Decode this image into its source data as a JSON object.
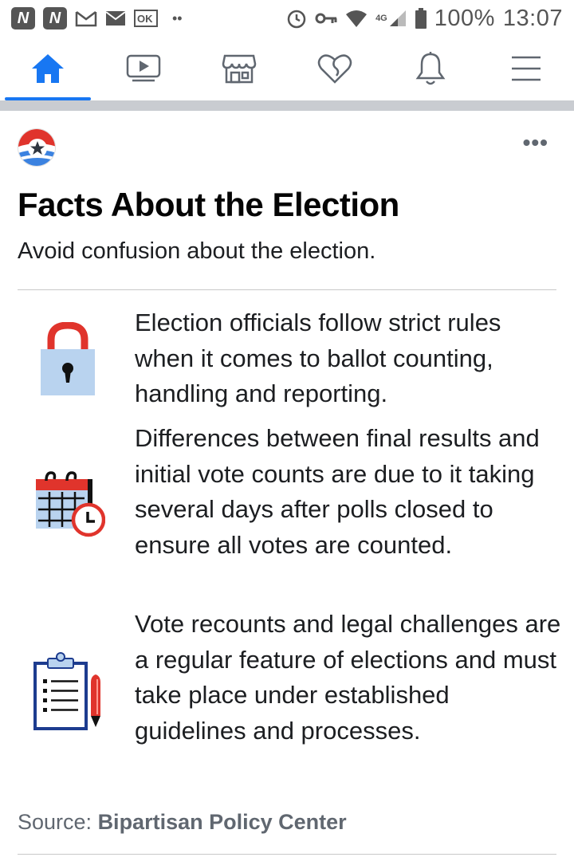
{
  "status_bar": {
    "battery": "100%",
    "time": "13:07",
    "network": "4G"
  },
  "nav": {
    "items": [
      {
        "icon": "home-icon",
        "active": true
      },
      {
        "icon": "video-icon",
        "active": false
      },
      {
        "icon": "marketplace-icon",
        "active": false
      },
      {
        "icon": "dating-heart-icon",
        "active": false
      },
      {
        "icon": "bell-icon",
        "active": false
      },
      {
        "icon": "menu-icon",
        "active": false
      }
    ],
    "active_color": "#1877f2"
  },
  "card": {
    "title": "Facts About the Election",
    "subtitle": "Avoid confusion about the election.",
    "more": "•••",
    "facts": [
      {
        "icon": "padlock-icon",
        "text": "Election officials follow strict rules when it comes to ballot counting, handling and reporting."
      },
      {
        "icon": "calendar-clock-icon",
        "text": "Differences between final results and initial vote counts are due to it taking several days after polls closed to ensure all votes are counted."
      },
      {
        "icon": "clipboard-pen-icon",
        "text": "Vote recounts and legal challenges are a regular feature of elections and must take place under established guidelines and processes."
      }
    ],
    "source_label": "Source: ",
    "source_name": "Bipartisan Policy Center"
  }
}
